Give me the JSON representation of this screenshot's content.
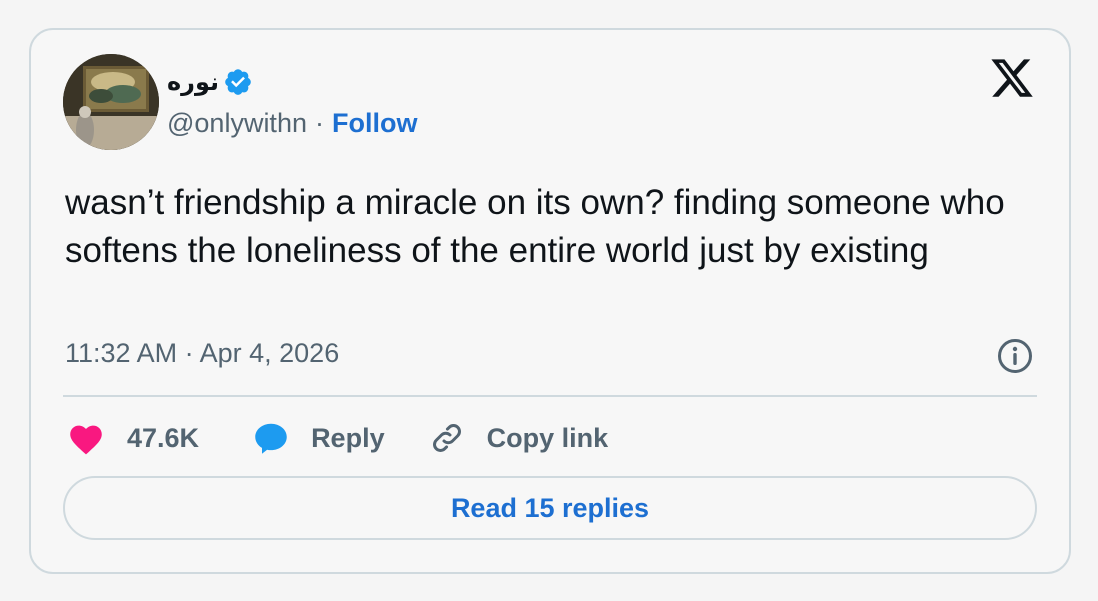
{
  "author": {
    "display_name": "نوره",
    "handle": "@onlywithn",
    "separator": "·",
    "follow_label": "Follow",
    "verified": true,
    "avatar": "avatar-painting-image"
  },
  "tweet": {
    "text": "wasn’t friendship a miracle on its own? finding someone who softens the loneliness of the entire world just by existing",
    "time": "11:32 AM",
    "date_separator": "·",
    "date": "Apr 4, 2026"
  },
  "actions": {
    "likes_count": "47.6K",
    "reply_label": "Reply",
    "copy_link_label": "Copy link"
  },
  "footer": {
    "read_replies_label": "Read 15 replies"
  },
  "icons": {
    "brand": "x-logo-icon",
    "verified": "verified-badge-icon",
    "info": "info-icon",
    "like": "heart-icon",
    "reply": "speech-bubble-icon",
    "copy": "link-icon"
  },
  "colors": {
    "accent": "#1d6fd1",
    "verified": "#1d9bf0",
    "heart": "#f91880",
    "muted": "#536471",
    "border": "#cfd9de"
  }
}
